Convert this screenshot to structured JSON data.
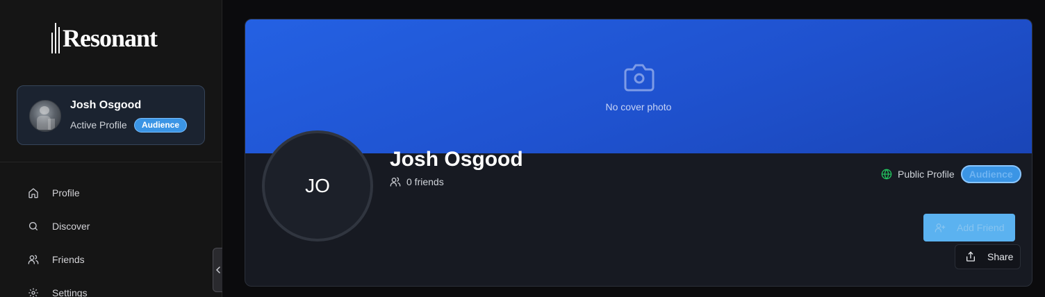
{
  "app": {
    "name": "Resonant"
  },
  "sidebar": {
    "active_profile": {
      "name": "Josh Osgood",
      "subtitle": "Active Profile",
      "badge": "Audience"
    },
    "nav": [
      {
        "label": "Profile",
        "icon": "home-icon"
      },
      {
        "label": "Discover",
        "icon": "search-icon"
      },
      {
        "label": "Friends",
        "icon": "users-icon"
      },
      {
        "label": "Settings",
        "icon": "gear-icon"
      }
    ]
  },
  "profile": {
    "cover_placeholder": "No cover photo",
    "initials": "JO",
    "name": "Josh Osgood",
    "friends": "0 friends",
    "visibility": "Public Profile",
    "badge": "Audience",
    "add_friend_label": "Add Friend",
    "share_label": "Share"
  },
  "colors": {
    "accent": "#3b95e5",
    "cover": "#2461e3",
    "globe": "#22c55e",
    "sidebar_bg": "#151515",
    "panel_bg": "#171a22"
  }
}
